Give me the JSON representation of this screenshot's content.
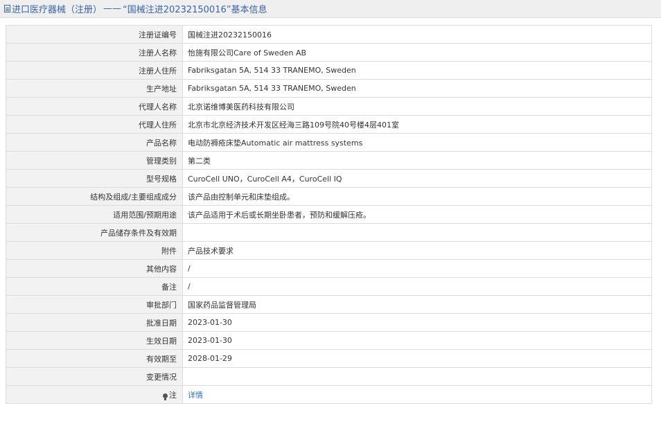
{
  "header": {
    "prefix": "进口医疗器械（注册）",
    "separator": "——",
    "title": "“国械注进20232150016”基本信息"
  },
  "rows": [
    {
      "label": "注册证编号",
      "value": "国械注进20232150016"
    },
    {
      "label": "注册人名称",
      "value": "怡施有限公司Care of Sweden AB"
    },
    {
      "label": "注册人住所",
      "value": "Fabriksgatan 5A, 514 33 TRANEMO, Sweden"
    },
    {
      "label": "生产地址",
      "value": "Fabriksgatan 5A, 514 33 TRANEMO, Sweden"
    },
    {
      "label": "代理人名称",
      "value": "北京诺维博美医药科技有限公司"
    },
    {
      "label": "代理人住所",
      "value": "北京市北京经济技术开发区经海三路109号院40号楼4层401室"
    },
    {
      "label": "产品名称",
      "value": "电动防褥疮床垫Automatic air mattress systems"
    },
    {
      "label": "管理类别",
      "value": "第二类"
    },
    {
      "label": "型号规格",
      "value": "CuroCell UNO，CuroCell A4，CuroCell IQ"
    },
    {
      "label": "结构及组成/主要组成成分",
      "value": "该产品由控制单元和床垫组成。"
    },
    {
      "label": "适用范围/预期用途",
      "value": "该产品适用于术后或长期坐卧患者，预防和缓解压疮。"
    },
    {
      "label": "产品储存条件及有效期",
      "value": ""
    },
    {
      "label": "附件",
      "value": "产品技术要求"
    },
    {
      "label": "其他内容",
      "value": "/"
    },
    {
      "label": "备注",
      "value": "/"
    },
    {
      "label": "审批部门",
      "value": "国家药品监督管理局"
    },
    {
      "label": "批准日期",
      "value": "2023-01-30"
    },
    {
      "label": "生效日期",
      "value": "2023-01-30"
    },
    {
      "label": "有效期至",
      "value": "2028-01-29"
    },
    {
      "label": "变更情况",
      "value": ""
    }
  ],
  "note": {
    "label": "注",
    "link": "详情",
    "icon": "lightbulb-icon"
  },
  "colors": {
    "header_text": "#3a63a8",
    "link": "#2f6fbf",
    "label_bg": "#f2f2f2",
    "border": "#dcdcdc"
  }
}
